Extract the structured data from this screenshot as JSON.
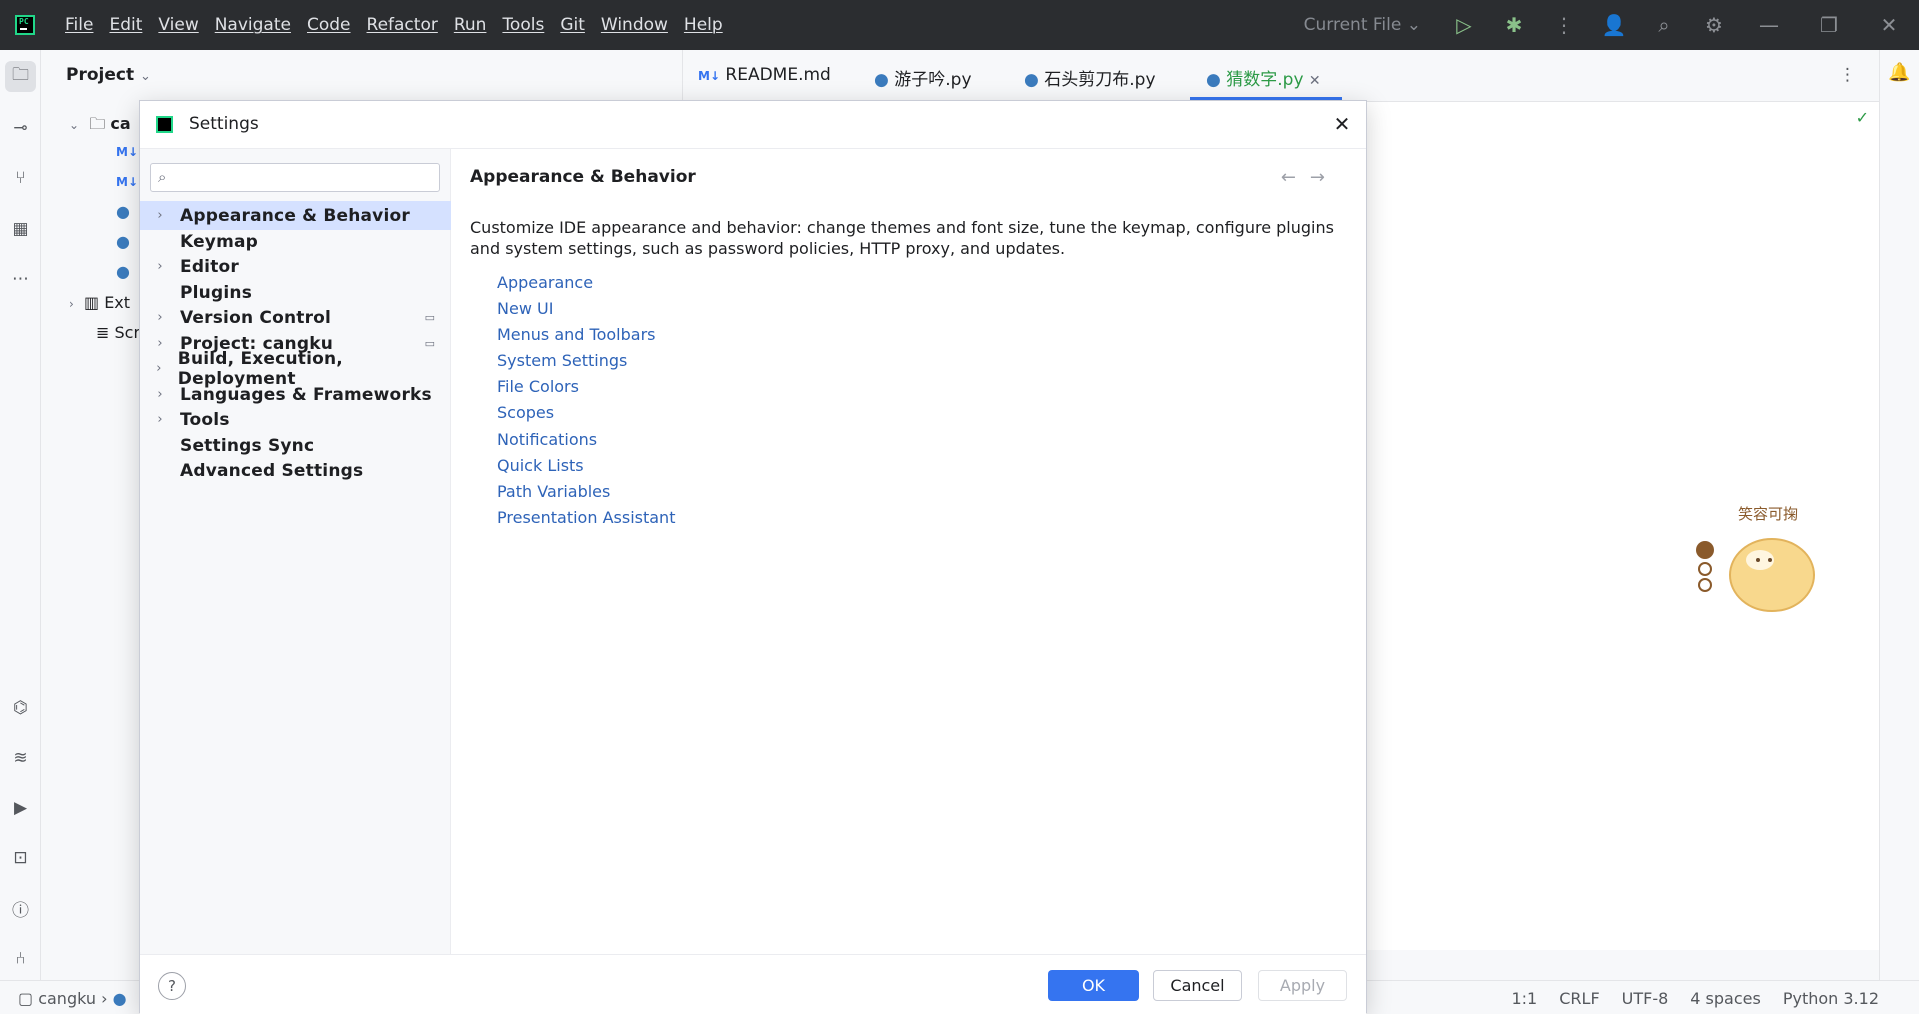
{
  "menu": [
    "File",
    "Edit",
    "View",
    "Navigate",
    "Code",
    "Refactor",
    "Run",
    "Tools",
    "Git",
    "Window",
    "Help"
  ],
  "run_config": "Current File",
  "project": {
    "title": "Project",
    "tree": [
      "ca",
      "M↓",
      "M↓",
      "Ext",
      "Scr"
    ]
  },
  "tabs": [
    {
      "label": "README.md"
    },
    {
      "label": "游子吟.py"
    },
    {
      "label": "石头剪刀布.py"
    },
    {
      "label": "猜数字.py"
    }
  ],
  "status": {
    "breadcrumb": "cangku",
    "position": "1:1",
    "line_sep": "CRLF",
    "encoding": "UTF-8",
    "indent": "4 spaces",
    "interpreter": "Python 3.12"
  },
  "sticker_text": "笑容可掬",
  "dialog": {
    "title": "Settings",
    "nav": [
      {
        "label": "Appearance & Behavior",
        "chevron": true,
        "selected": true
      },
      {
        "label": "Keymap",
        "chevron": false
      },
      {
        "label": "Editor",
        "chevron": true
      },
      {
        "label": "Plugins",
        "chevron": false
      },
      {
        "label": "Version Control",
        "chevron": true,
        "mark": true
      },
      {
        "label": "Project: cangku",
        "chevron": true,
        "mark": true
      },
      {
        "label": "Build, Execution, Deployment",
        "chevron": true
      },
      {
        "label": "Languages & Frameworks",
        "chevron": true
      },
      {
        "label": "Tools",
        "chevron": true
      },
      {
        "label": "Settings Sync",
        "chevron": false
      },
      {
        "label": "Advanced Settings",
        "chevron": false
      }
    ],
    "section_title": "Appearance & Behavior",
    "description": "Customize IDE appearance and behavior: change themes and font size, tune the keymap, configure plugins and system settings, such as password policies, HTTP proxy, and updates.",
    "links": [
      "Appearance",
      "New UI",
      "Menus and Toolbars",
      "System Settings",
      "File Colors",
      "Scopes",
      "Notifications",
      "Quick Lists",
      "Path Variables",
      "Presentation Assistant"
    ],
    "ok": "OK",
    "cancel": "Cancel",
    "apply": "Apply"
  }
}
